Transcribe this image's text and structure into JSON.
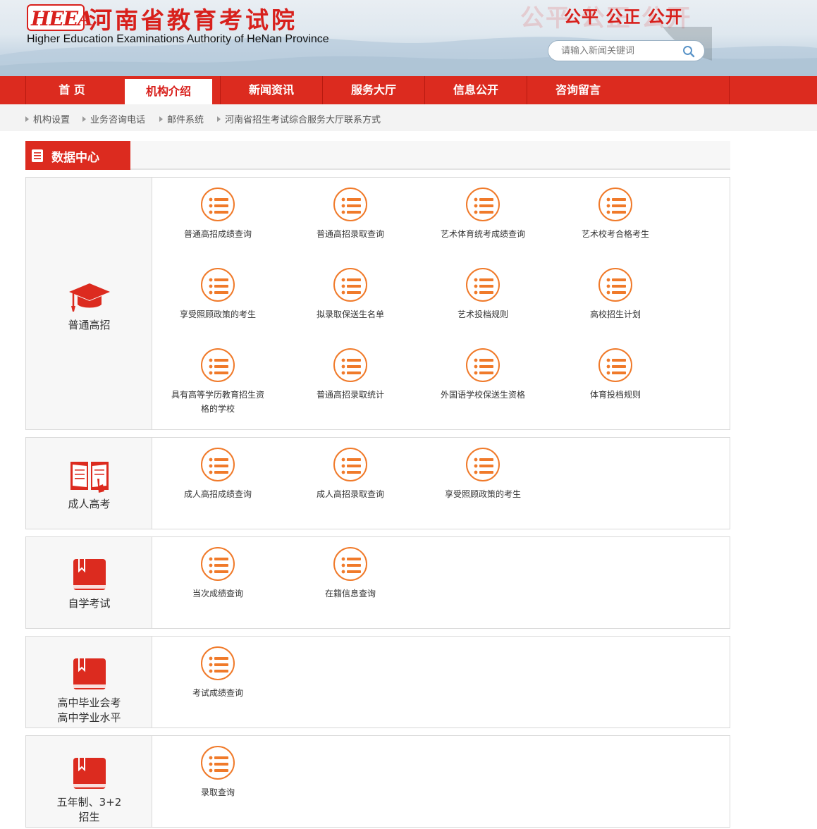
{
  "header": {
    "logo_badge": "HEEA",
    "logo_cn": "河南省教育考试院",
    "logo_en": "Higher Education Examinations Authority of HeNan Province",
    "slogan": "公平 公正 公开",
    "search_placeholder": "请输入新闻关键词"
  },
  "nav": {
    "items": [
      "首 页",
      "机构介绍",
      "新闻资讯",
      "服务大厅",
      "信息公开",
      "咨询留言"
    ],
    "active_index": 1
  },
  "sublinks": [
    "机构设置",
    "业务咨询电话",
    "邮件系统",
    "河南省招生考试综合服务大厅联系方式"
  ],
  "section_title": "数据中心",
  "categories": [
    {
      "label": "普通高招",
      "icon": "graduation-cap-icon",
      "items": [
        "普通高招成绩查询",
        "普通高招录取查询",
        "艺术体育统考成绩查询",
        "艺术校考合格考生",
        "享受照顾政策的考生",
        "拟录取保送生名单",
        "艺术投档规则",
        "高校招生计划",
        "具有高等学历教育招生资格的学校",
        "普通高招录取统计",
        "外国语学校保送生资格",
        "体育投档规则"
      ]
    },
    {
      "label": "成人高考",
      "icon": "open-book-icon",
      "items": [
        "成人高招成绩查询",
        "成人高招录取查询",
        "享受照顾政策的考生"
      ]
    },
    {
      "label": "自学考试",
      "icon": "closed-book-icon",
      "items": [
        "当次成绩查询",
        "在籍信息查询"
      ]
    },
    {
      "label_lines": [
        "高中毕业会考",
        "高中学业水平"
      ],
      "icon": "closed-book-icon",
      "items": [
        "考试成绩查询"
      ]
    },
    {
      "label_lines": [
        "五年制、3+2",
        "招生"
      ],
      "icon": "closed-book-icon",
      "items": [
        "录取查询"
      ]
    }
  ],
  "colors": {
    "brand_red": "#dc2b1f",
    "accent_orange": "#f07a2a"
  }
}
